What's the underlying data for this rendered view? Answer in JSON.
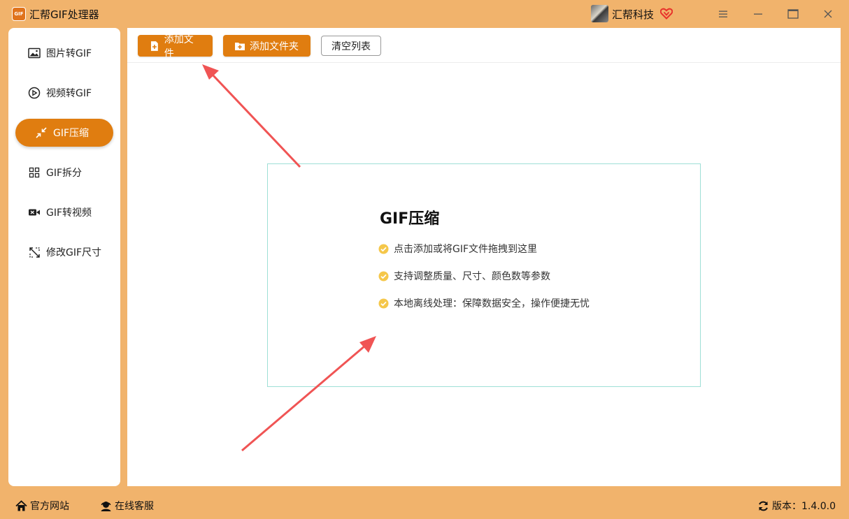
{
  "app": {
    "title": "汇帮GIF处理器",
    "logo_text": "GIF",
    "user_name": "汇帮科技",
    "accent_color": "#e07d10",
    "background_color": "#f1b36c"
  },
  "window_controls": [
    "menu-icon",
    "minimize-icon",
    "maximize-icon",
    "close-icon"
  ],
  "sidebar": {
    "items": [
      {
        "label": "图片转GIF",
        "icon": "image-icon",
        "active": false
      },
      {
        "label": "视频转GIF",
        "icon": "play-circle-icon",
        "active": false
      },
      {
        "label": "GIF压缩",
        "icon": "compress-arrows-icon",
        "active": true
      },
      {
        "label": "GIF拆分",
        "icon": "split-grid-icon",
        "active": false
      },
      {
        "label": "GIF转视频",
        "icon": "video-camera-icon",
        "active": false
      },
      {
        "label": "修改GIF尺寸",
        "icon": "resize-icon",
        "active": false
      }
    ]
  },
  "toolbar": {
    "add_file_label": "添加文件",
    "add_folder_label": "添加文件夹",
    "clear_list_label": "清空列表"
  },
  "drop_zone": {
    "title": "GIF压缩",
    "features": [
      "点击添加或将GIF文件拖拽到这里",
      "支持调整质量、尺寸、颜色数等参数",
      "本地离线处理：保障数据安全，操作便捷无忧"
    ]
  },
  "footer": {
    "website_label": "官方网站",
    "support_label": "在线客服",
    "version_label": "版本：1.4.0.0"
  }
}
